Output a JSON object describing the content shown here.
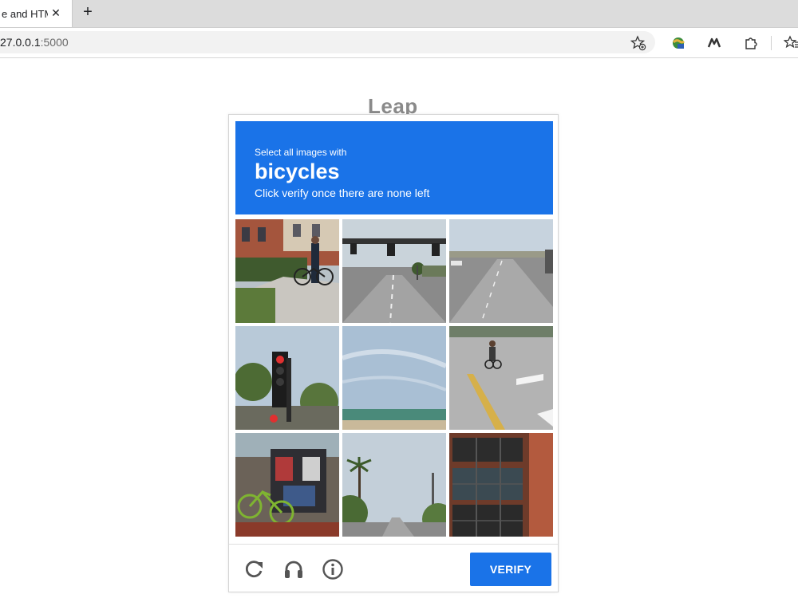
{
  "browser": {
    "tab_title": "e and HTML",
    "close_glyph": "✕",
    "new_tab_glyph": "+",
    "address_host": "27.0.0.1",
    "address_port": ":5000"
  },
  "page": {
    "heading": "Leap"
  },
  "captcha": {
    "prompt": "Select all images with",
    "target": "bicycles",
    "instruction": "Click verify once there are none left",
    "verify_label": "VERIFY",
    "accent_color": "#1a73e8",
    "tiles": [
      {
        "subject": "building with man and bicycle on sidewalk"
      },
      {
        "subject": "traffic lights over road"
      },
      {
        "subject": "highway with cars"
      },
      {
        "subject": "red traffic light with trees"
      },
      {
        "subject": "sky with bridge"
      },
      {
        "subject": "cyclist on road with crosswalk"
      },
      {
        "subject": "bicycle by news boxes"
      },
      {
        "subject": "palm trees and street"
      },
      {
        "subject": "brick building windows"
      }
    ]
  }
}
